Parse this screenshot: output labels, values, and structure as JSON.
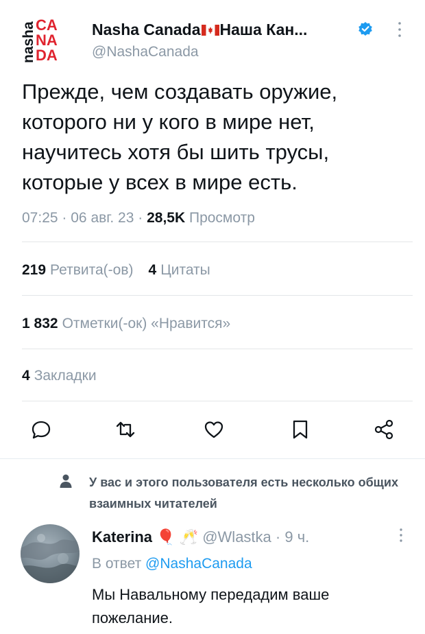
{
  "tweet": {
    "author_name": "Nasha Canada",
    "author_name_suffix": "Наша Кан...",
    "handle": "@NashaCanada",
    "logo_text": {
      "vertical": "nasha",
      "line1": "CA",
      "line2": "NA",
      "line3": "DA"
    },
    "text": "Прежде, чем создавать оружие, которого ни у кого в мире нет, научитесь хотя бы шить трусы, которые у всех в мире есть.",
    "time": "07:25",
    "date": "06 авг. 23",
    "views_count": "28,5K",
    "views_label": "Просмотр",
    "separator": "·"
  },
  "stats": {
    "retweets_count": "219",
    "retweets_label": "Ретвита(-ов)",
    "quotes_count": "4",
    "quotes_label": "Цитаты",
    "likes_count": "1 832",
    "likes_label": "Отметки(-ок) «Нравится»",
    "bookmarks_count": "4",
    "bookmarks_label": "Закладки"
  },
  "actions": [
    "reply-icon",
    "retweet-icon",
    "like-icon",
    "bookmark-icon",
    "share-icon"
  ],
  "notice": "У вас и этого пользователя есть несколько общих взаимных читателей",
  "reply": {
    "name": "Katerina",
    "emoji": "🎈 🥂",
    "handle": "@Wlastka",
    "separator": "·",
    "time": "9 ч.",
    "in_reply_prefix": "В ответ",
    "in_reply_handle": "@NashaCanada",
    "text": "Мы Навальному передадим ваше пожелание."
  },
  "colors": {
    "accent": "#1d9bf0",
    "logo_red": "#e0242f",
    "text": "#0f1419",
    "secondary": "#8b98a5"
  }
}
